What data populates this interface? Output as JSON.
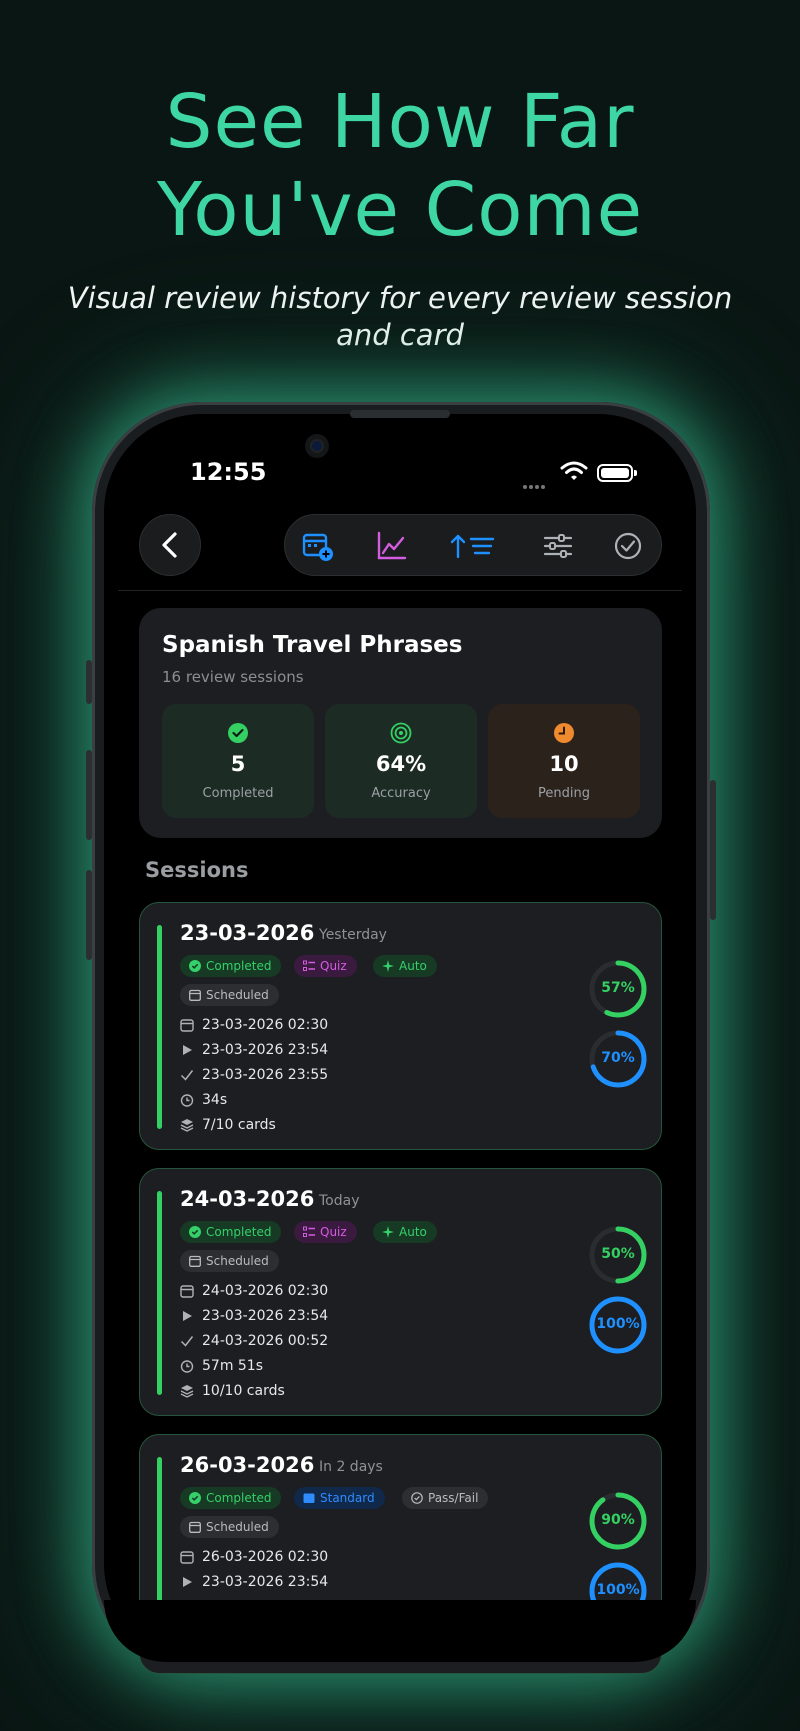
{
  "promo": {
    "headline_line1": "See How Far",
    "headline_line2": "You've Come",
    "subline_line1": "Visual review history for every review session",
    "subline_line2": "and card"
  },
  "status_bar": {
    "time": "12:55"
  },
  "toolbar": {
    "back_icon": "chevron-left-icon",
    "icons": [
      "calendar-add-icon",
      "line-chart-icon",
      "sort-up-icon",
      "sliders-icon",
      "check-circle-icon"
    ]
  },
  "deck": {
    "title": "Spanish Travel Phrases",
    "subtitle": "16 review sessions",
    "stats": [
      {
        "value": "5",
        "label": "Completed",
        "icon": "check-circle-icon",
        "color": "#34d062"
      },
      {
        "value": "64%",
        "label": "Accuracy",
        "icon": "target-icon",
        "color": "#34d062"
      },
      {
        "value": "10",
        "label": "Pending",
        "icon": "clock-icon",
        "color": "#f08a2e"
      }
    ]
  },
  "sessions_heading": "Sessions",
  "sessions": [
    {
      "date": "23-03-2026",
      "relative": "Yesterday",
      "chips": [
        "Completed",
        "Quiz",
        "Auto",
        "Scheduled"
      ],
      "scheduled": "23-03-2026 02:30",
      "started": "23-03-2026 23:54",
      "finished": "23-03-2026 23:55",
      "duration": "34s",
      "cards": "7/10 cards",
      "ring_green": "57%",
      "ring_blue": "70%",
      "green_fraction": 0.57,
      "blue_fraction": 0.7
    },
    {
      "date": "24-03-2026",
      "relative": "Today",
      "chips": [
        "Completed",
        "Quiz",
        "Auto",
        "Scheduled"
      ],
      "scheduled": "24-03-2026 02:30",
      "started": "23-03-2026 23:54",
      "finished": "24-03-2026 00:52",
      "duration": "57m 51s",
      "cards": "10/10 cards",
      "ring_green": "50%",
      "ring_blue": "100%",
      "green_fraction": 0.5,
      "blue_fraction": 1.0
    },
    {
      "date": "26-03-2026",
      "relative": "In 2 days",
      "chips": [
        "Completed",
        "Standard",
        "Pass/Fail",
        "Scheduled"
      ],
      "scheduled": "26-03-2026 02:30",
      "started": "23-03-2026 23:54",
      "ring_green": "90%",
      "ring_blue": "100%",
      "green_fraction": 0.9,
      "blue_fraction": 1.0
    }
  ],
  "colors": {
    "accent": "#3ed6a3",
    "green": "#34d062",
    "blue": "#1e90ff",
    "purple": "#d45ce0"
  }
}
